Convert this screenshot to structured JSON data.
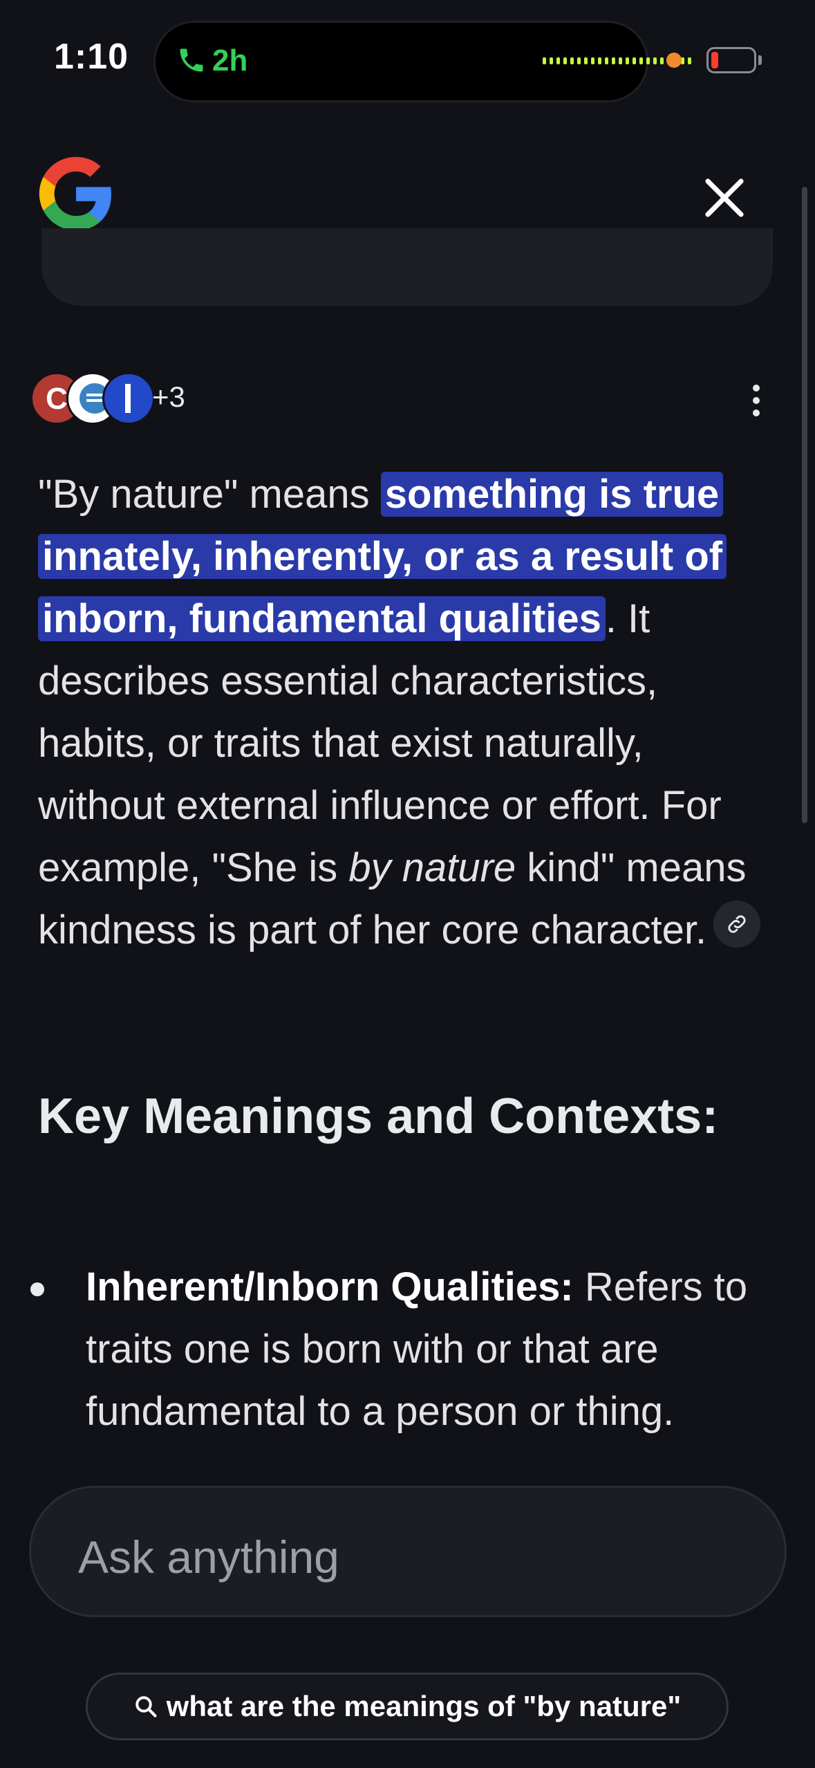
{
  "status_bar": {
    "time": "1:10",
    "call_duration": "2h",
    "call_color": "#34d058",
    "battery_color": "#ff3b30"
  },
  "header": {
    "logo_icon": "google-g-logo",
    "close_icon": "close-icon"
  },
  "sources": {
    "more_count": "+3",
    "more_menu_icon": "vertical-dots-icon"
  },
  "answer": {
    "intro": "\"By nature\" means ",
    "highlight": "something is true innately, inherently, or as a result of inborn, fundamental qualities",
    "rest_1": ". It describes essential characteristics, habits, or traits that exist naturally, without external influence or effort. For example, \"She is ",
    "italic": "by nature",
    "rest_2": " kind\" means kindness is part of her core character.",
    "link_icon": "link-icon",
    "highlight_color": "#2a3aa8"
  },
  "section": {
    "title": "Key Meanings and Contexts:"
  },
  "bullets": [
    {
      "term": "Inherent/Inborn Qualities:",
      "description": " Refers to traits one is born with or that are fundamental to a person or thing."
    }
  ],
  "ask": {
    "placeholder": "Ask anything"
  },
  "query_pill": {
    "icon": "search-icon",
    "text": "what are the meanings of \"by nature\""
  }
}
